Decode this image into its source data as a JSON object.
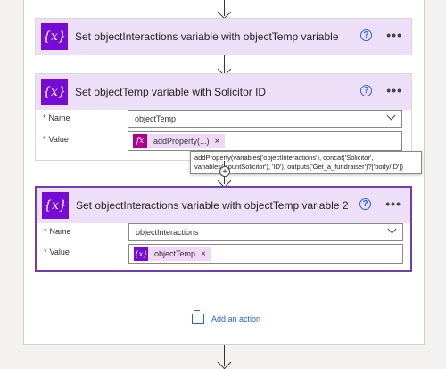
{
  "cards": [
    {
      "title": "Set objectInteractions variable with objectTemp variable",
      "help": "?",
      "more": "•••"
    },
    {
      "title": "Set objectTemp variable with Solicitor ID",
      "help": "?",
      "more": "•••",
      "name_label": "Name",
      "name_value": "objectTemp",
      "value_label": "Value",
      "token_label": "addProperty(...)",
      "token_icon": "fx",
      "token_close": "×"
    },
    {
      "title": "Set objectInteractions variable with objectTemp variable 2",
      "help": "?",
      "more": "•••",
      "name_label": "Name",
      "name_value": "objectInteractions",
      "value_label": "Value",
      "token_label": "objectTemp",
      "token_icon": "{x}",
      "token_close": "×"
    }
  ],
  "required_mark": "*",
  "header_icon": "{x}",
  "tooltip": "addProperty(variables('objectInteractions'), concat('Solicitor', variables('countSolicitor'), 'ID'), outputs('Get_a_fundraiser')?['body/ID'])",
  "plus": "+",
  "add_action": "Add an action",
  "colors": {
    "variable_icon": "#770bd6",
    "expression_icon": "#ad008c",
    "header_bg": "#ecdff7",
    "link": "#2b62d9"
  }
}
